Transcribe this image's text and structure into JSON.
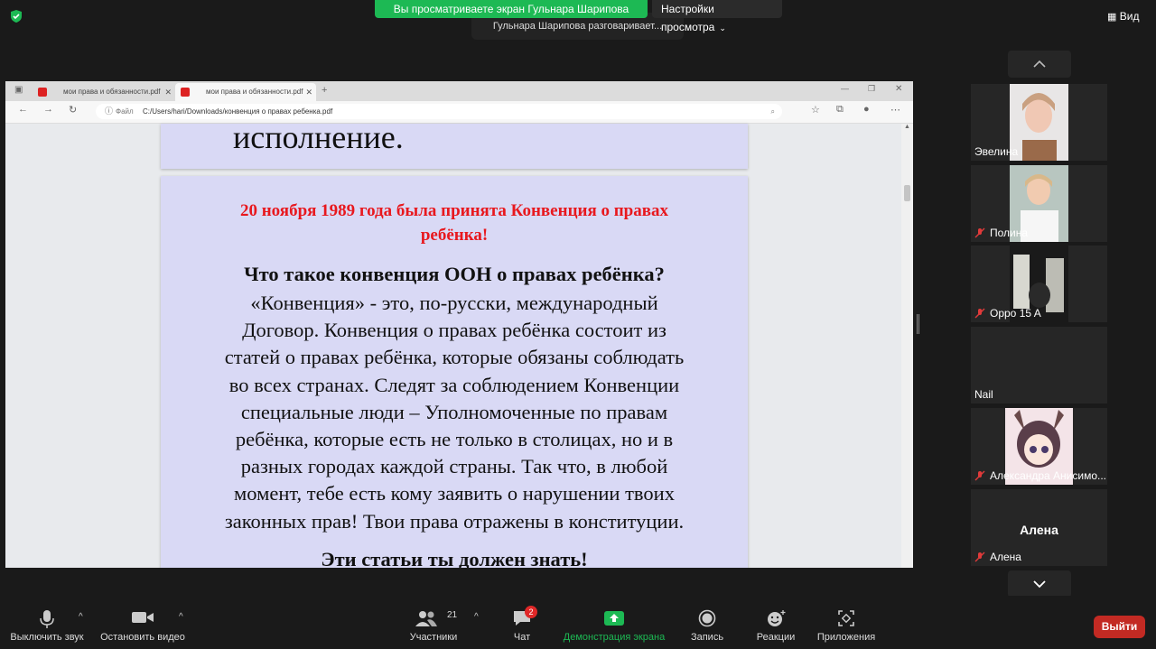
{
  "top": {
    "share_banner": "Вы просматриваете экран Гульнара Шарипова",
    "view_options": "Настройки просмотра",
    "speaking": "Гульнара Шарипова разговаривает...",
    "view_button": "Вид",
    "shield_icon": "security-shield-icon"
  },
  "browser": {
    "tabs": [
      {
        "title": "мои права и обязанности.pdf"
      },
      {
        "title": "мои права и обязанности.pdf"
      }
    ],
    "address": {
      "scheme_label": "Файл",
      "url": "C:/Users/hari/Downloads/конвенция о правах ребенка.pdf"
    }
  },
  "document": {
    "prev_slide_text": "исполнение.",
    "red_title_lines": [
      "20 ноября 1989 года была принята Конвенция о правах",
      "ребёнка!"
    ],
    "question": "Что такое конвенция ООН о правах ребёнка?",
    "body_lines": [
      "«Конвенция» - это, по-русски,  международный",
      "Договор. Конвенция о правах ребёнка состоит из",
      "статей о правах ребёнка, которые обязаны соблюдать",
      "во всех странах. Следят за соблюдением Конвенции",
      "специальные люди – Уполномоченные по правам",
      "ребёнка, которые есть не только в столицах, но и в",
      "разных городах каждой страны. Так что, в любой",
      "момент, тебе есть кому заявить о нарушении твоих",
      "законных прав! Твои права отражены в конституции."
    ],
    "bottom_heading": "Эти статьи ты должен знать!",
    "colors": {
      "slide_bg": "#d9d9f5",
      "red_title": "#e8181e"
    }
  },
  "participants": [
    {
      "name": "Эвелина",
      "muted": false,
      "video": true
    },
    {
      "name": "Полина",
      "muted": true,
      "video": true
    },
    {
      "name": "Oppo 15 A",
      "muted": true,
      "video": true
    },
    {
      "name": "Nail",
      "muted": false,
      "video": false
    },
    {
      "name": "Александра Анисимо...",
      "muted": true,
      "video": true
    },
    {
      "name": "Алена",
      "muted": true,
      "video": false,
      "big_label": "Алена"
    }
  ],
  "toolbar": {
    "mute": "Выключить звук",
    "stop_video": "Остановить видео",
    "participants": "Участники",
    "participants_count": "21",
    "chat": "Чат",
    "chat_badge": "2",
    "share_screen": "Демонстрация экрана",
    "record": "Запись",
    "reactions": "Реакции",
    "apps": "Приложения",
    "leave": "Выйти",
    "accent_green": "#1db954",
    "leave_red": "#c32a23"
  }
}
